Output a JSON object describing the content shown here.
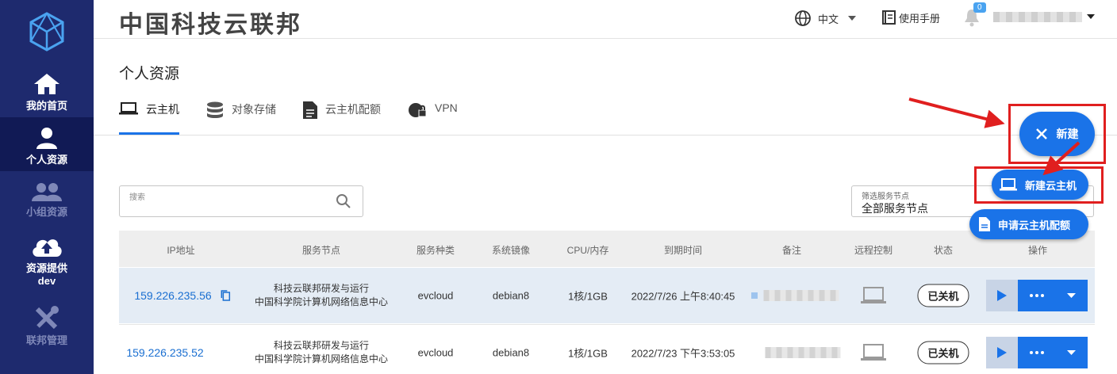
{
  "brand": {
    "title": "中国科技云联邦"
  },
  "sidebar": {
    "items": [
      {
        "label": "我的首页"
      },
      {
        "label": "个人资源"
      },
      {
        "label": "小组资源"
      },
      {
        "label": "资源提供",
        "sub": "dev"
      },
      {
        "label": "联邦管理"
      }
    ]
  },
  "header": {
    "language": "中文",
    "manual": "使用手册",
    "notification_count": "0"
  },
  "page": {
    "title": "个人资源",
    "tabs": [
      {
        "label": "云主机"
      },
      {
        "label": "对象存储"
      },
      {
        "label": "云主机配额"
      },
      {
        "label": "VPN"
      }
    ]
  },
  "search": {
    "placeholder": "搜索"
  },
  "filter": {
    "label": "筛选服务节点",
    "value": "全部服务节点"
  },
  "table": {
    "columns": [
      "IP地址",
      "服务节点",
      "服务种类",
      "系统镜像",
      "CPU/内存",
      "到期时间",
      "备注",
      "远程控制",
      "状态",
      "操作"
    ],
    "rows": [
      {
        "ip": "159.226.235.56",
        "node_line1": "科技云联邦研发与运行",
        "node_line2": "中国科学院计算机网络信息中心",
        "service": "evcloud",
        "image": "debian8",
        "cpu_mem": "1核/1GB",
        "expire": "2022/7/26 上午8:40:45",
        "status": "已关机"
      },
      {
        "ip": "159.226.235.52",
        "node_line1": "科技云联邦研发与运行",
        "node_line2": "中国科学院计算机网络信息中心",
        "service": "evcloud",
        "image": "debian8",
        "cpu_mem": "1核/1GB",
        "expire": "2022/7/23 下午3:53:05",
        "status": "已关机"
      }
    ]
  },
  "fab": {
    "label": "新建",
    "menu": [
      {
        "label": "新建云主机"
      },
      {
        "label": "申请云主机配额"
      }
    ]
  },
  "colors": {
    "sidebar": "#1e2a6e",
    "accent": "#1a73e8",
    "highlight": "#e01f1f"
  }
}
